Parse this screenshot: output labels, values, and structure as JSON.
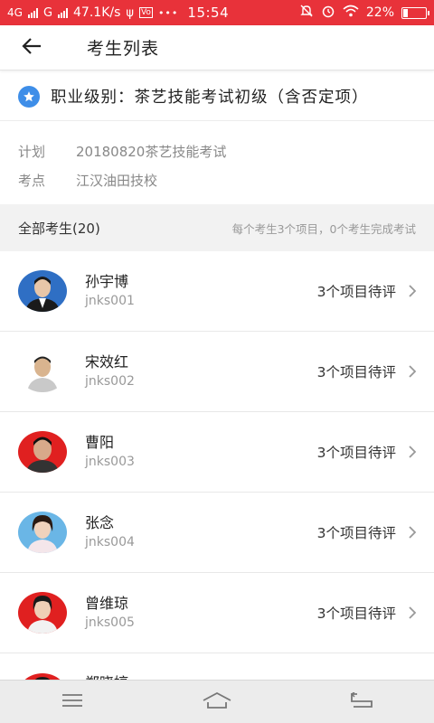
{
  "status_bar": {
    "sim1": "4G",
    "sim2": "G",
    "speed": "47.1K/s",
    "dots": "•••",
    "time": "15:54",
    "battery": "22%",
    "battery_level": 0.22,
    "bg_color": "#e8323a"
  },
  "header": {
    "title": "考生列表"
  },
  "level": {
    "text": "职业级别：茶艺技能考试初级（含否定项）",
    "icon": "star-icon",
    "icon_color": "#3e8ee8"
  },
  "info": {
    "plan_label": "计划",
    "plan_value": "20180820茶艺技能考试",
    "site_label": "考点",
    "site_value": "江汉油田技校"
  },
  "section": {
    "title": "全部考生(20)",
    "note": "每个考生3个项目，0个考生完成考试"
  },
  "students": [
    {
      "name": "孙宇博",
      "id": "jnks001",
      "status": "3个项目待评",
      "avatar_bg": "#2f6fc4"
    },
    {
      "name": "宋效红",
      "id": "jnks002",
      "status": "3个项目待评",
      "avatar_bg": "#ffffff"
    },
    {
      "name": "曹阳",
      "id": "jnks003",
      "status": "3个项目待评",
      "avatar_bg": "#e02020"
    },
    {
      "name": "张念",
      "id": "jnks004",
      "status": "3个项目待评",
      "avatar_bg": "#6ab6e6"
    },
    {
      "name": "曾维琼",
      "id": "jnks005",
      "status": "3个项目待评",
      "avatar_bg": "#e02020"
    },
    {
      "name": "郑晓婷",
      "id": "",
      "status": "",
      "avatar_bg": "#e02020"
    }
  ],
  "nav": {
    "menu_icon": "menu-icon",
    "home_icon": "home-icon",
    "back_icon": "back-nav-icon"
  }
}
